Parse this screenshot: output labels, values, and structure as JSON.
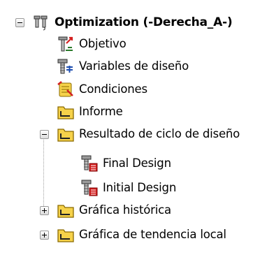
{
  "tree": {
    "root": {
      "label": "Optimization (-Derecha_A-)",
      "icon": "optimization-study-icon",
      "expanded": true
    },
    "children": [
      {
        "label": "Objetivo",
        "icon": "objective-icon"
      },
      {
        "label": "Variables de diseño",
        "icon": "design-variables-icon"
      },
      {
        "label": "Condiciones",
        "icon": "constraints-icon"
      },
      {
        "label": "Informe",
        "icon": "folder-icon"
      },
      {
        "label": "Resultado de ciclo de diseño",
        "icon": "folder-icon",
        "expanded": true,
        "children": [
          {
            "label": "Final Design",
            "icon": "design-result-icon"
          },
          {
            "label": "Initial Design",
            "icon": "design-result-icon"
          }
        ]
      },
      {
        "label": "Gráfica histórica",
        "icon": "folder-icon",
        "expanded": false
      },
      {
        "label": "Gráfica de tendencia local",
        "icon": "folder-icon",
        "expanded": false
      }
    ]
  },
  "colors": {
    "folder_yellow": "#f6d24a",
    "folder_outline": "#8a6a00",
    "accent_red": "#d42020",
    "metal_gray": "#8e8e8e"
  }
}
